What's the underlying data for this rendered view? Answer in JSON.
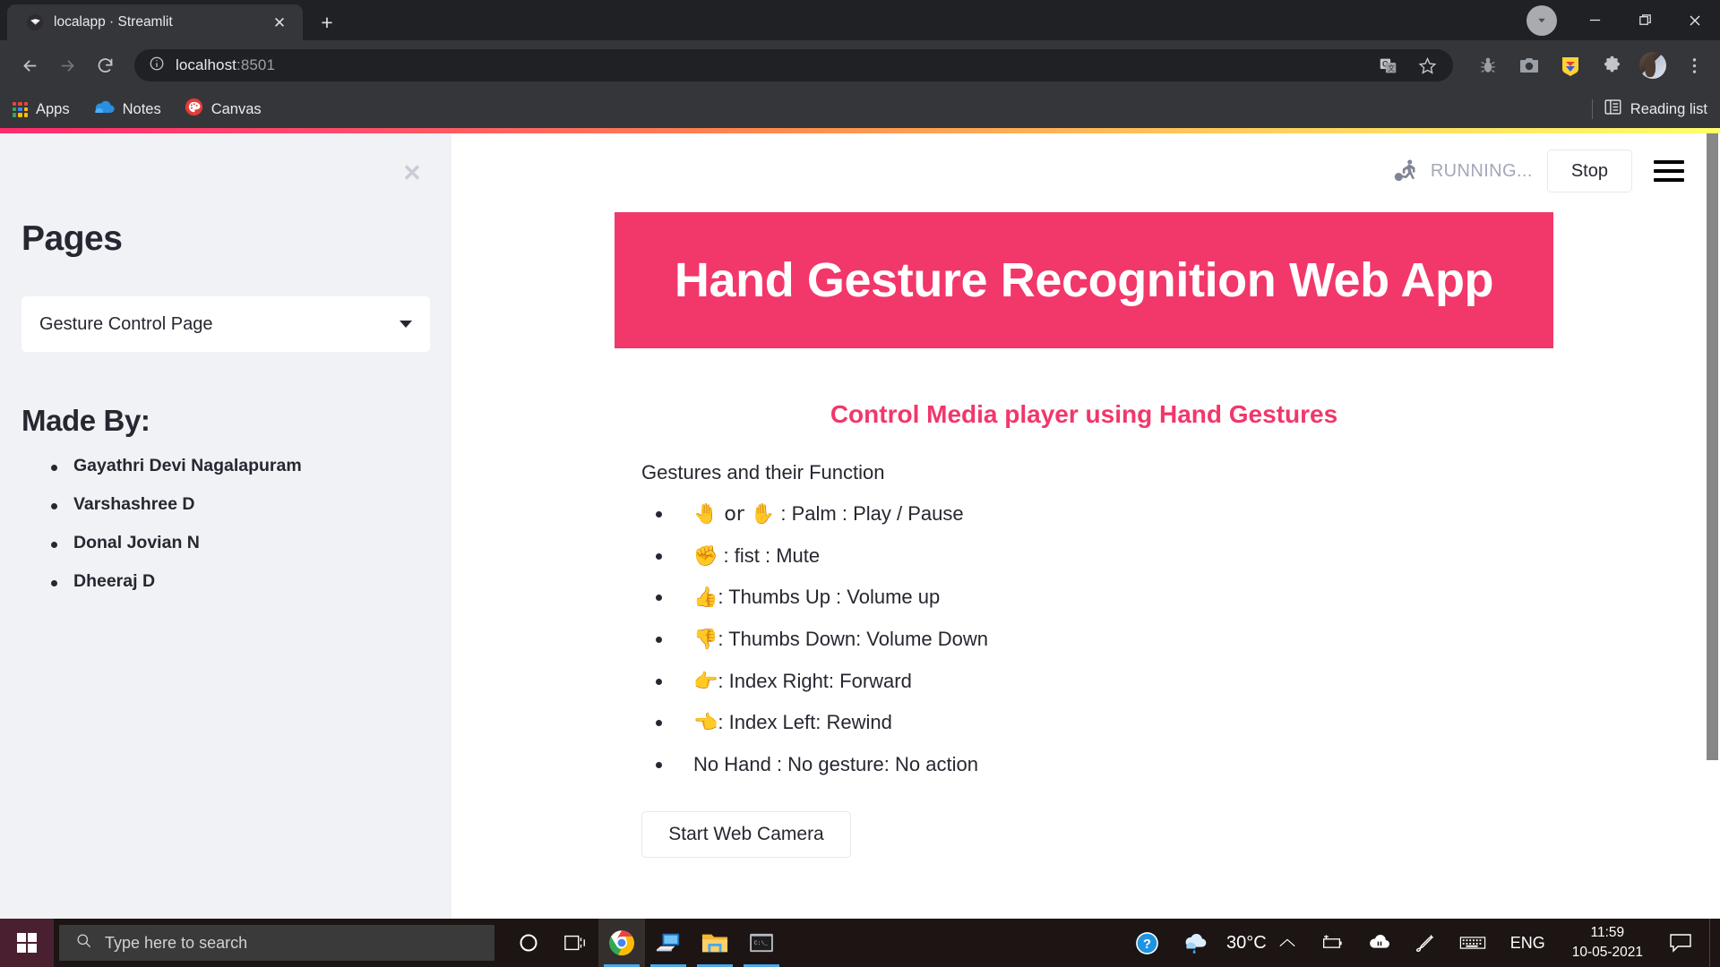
{
  "browser": {
    "tab": {
      "title": "localapp · Streamlit",
      "favicon": "streamlit-favicon",
      "close_label": "✕"
    },
    "new_tab_label": "+",
    "window_controls": {
      "minimize": "—",
      "maximize": "❐",
      "close": "✕"
    },
    "address_bar": {
      "host": "localhost",
      "port": ":8501",
      "info_icon": "info-circle-icon"
    },
    "nav": {
      "back": "back-arrow-icon",
      "forward": "forward-arrow-icon",
      "reload": "reload-icon"
    },
    "toolbar_icons": [
      "translate-icon",
      "star-bookmark-icon",
      "bug-icon",
      "camera-icon",
      "extension-colorful-icon",
      "puzzle-extensions-icon",
      "profile-avatar-icon",
      "three-dot-menu-icon"
    ],
    "bookmarks": [
      {
        "label": "Apps",
        "icon": "apps-grid-icon"
      },
      {
        "label": "Notes",
        "icon": "onedrive-cloud-icon"
      },
      {
        "label": "Canvas",
        "icon": "canvas-palette-icon"
      }
    ],
    "reading_list": {
      "label": "Reading list",
      "icon": "reading-list-icon"
    }
  },
  "sidebar": {
    "close_label": "✕",
    "heading": "Pages",
    "page_select": {
      "value": "Gesture Control Page",
      "caret": "chevron-down-icon"
    },
    "made_by_heading": "Made By:",
    "authors": [
      "Gayathri Devi Nagalapuram",
      "Varshashree D",
      "Donal Jovian N",
      "Dheeraj D"
    ]
  },
  "app_header": {
    "status_icon": "running-person-icon",
    "status_text": "RUNNING...",
    "stop_label": "Stop",
    "menu_icon": "hamburger-menu-icon"
  },
  "main": {
    "banner_title": "Hand Gesture Recognition Web App",
    "banner_color": "#F2376A",
    "subtitle": "Control Media player using Hand Gestures",
    "subtitle_color": "#F2376A",
    "gestures_intro": "Gestures and their Function",
    "gestures": [
      {
        "emoji": "🤚 or ✋",
        "text": " : Palm : Play / Pause"
      },
      {
        "emoji": "✊",
        "text": " : fist : Mute"
      },
      {
        "emoji": "👍",
        "text": ": Thumbs Up : Volume up"
      },
      {
        "emoji": "👎",
        "text": ": Thumbs Down: Volume Down"
      },
      {
        "emoji": "👉",
        "text": ": Index Right: Forward"
      },
      {
        "emoji": "👈",
        "text": ": Index Left: Rewind"
      },
      {
        "emoji": "",
        "text": "No Hand : No gesture: No action"
      }
    ],
    "start_camera_label": "Start Web Camera"
  },
  "taskbar": {
    "start_icon": "windows-start-icon",
    "search_placeholder": "Type here to search",
    "search_icon": "search-icon",
    "apps": [
      {
        "name": "cortana-icon"
      },
      {
        "name": "task-view-icon"
      },
      {
        "name": "google-chrome-icon"
      },
      {
        "name": "remote-desktop-icon"
      },
      {
        "name": "file-explorer-icon"
      },
      {
        "name": "command-prompt-icon"
      }
    ],
    "tray": {
      "help_icon": "help-question-icon",
      "weather_icon": "weather-rain-cloud-icon",
      "temperature": "30°C",
      "chevron_icon": "chevron-up-icon",
      "battery_icon": "battery-charging-icon",
      "onedrive_icon": "cloud-sync-icon",
      "pen_icon": "pen-icon",
      "keyboard_icon": "keyboard-icon",
      "language": "ENG",
      "time": "11:59",
      "date": "10-05-2021",
      "notification_icon": "notification-bubble-icon"
    }
  }
}
